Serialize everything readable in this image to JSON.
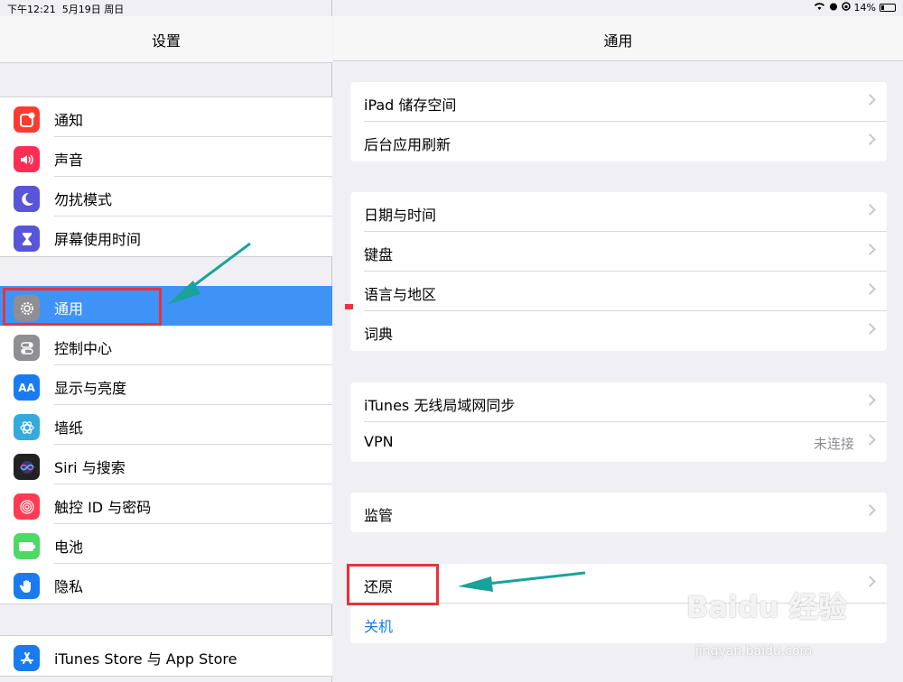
{
  "status": {
    "time": "下午12:21",
    "date": "5月19日 周日",
    "battery": "14%"
  },
  "sidebar": {
    "title": "设置",
    "group1": [
      {
        "label": "通知",
        "icon": "notifications-icon",
        "color": "#fd3b30"
      },
      {
        "label": "声音",
        "icon": "speaker-icon",
        "color": "#fd2d55"
      },
      {
        "label": "勿扰模式",
        "icon": "moon-icon",
        "color": "#5856d6"
      },
      {
        "label": "屏幕使用时间",
        "icon": "hourglass-icon",
        "color": "#5856d6"
      }
    ],
    "group2": [
      {
        "label": "通用",
        "icon": "gear-icon",
        "color": "#8e8e93"
      },
      {
        "label": "控制中心",
        "icon": "toggles-icon",
        "color": "#8e8e93"
      },
      {
        "label": "显示与亮度",
        "icon": "text-size-icon",
        "color": "#1a7bf0"
      },
      {
        "label": "墙纸",
        "icon": "flower-icon",
        "color": "#35aadc"
      },
      {
        "label": "Siri 与搜索",
        "icon": "siri-icon",
        "color": "#222222"
      },
      {
        "label": "触控 ID 与密码",
        "icon": "fingerprint-icon",
        "color": "#fd3b54"
      },
      {
        "label": "电池",
        "icon": "battery-icon",
        "color": "#4cd964"
      },
      {
        "label": "隐私",
        "icon": "hand-icon",
        "color": "#1a7bf0"
      }
    ],
    "group3": [
      {
        "label": "iTunes Store 与 App Store",
        "icon": "app-store-icon",
        "color": "#1a7bf0"
      }
    ]
  },
  "main": {
    "title": "通用",
    "card1": [
      {
        "label": "iPad 储存空间"
      },
      {
        "label": "后台应用刷新"
      }
    ],
    "card2": [
      {
        "label": "日期与时间"
      },
      {
        "label": "键盘"
      },
      {
        "label": "语言与地区"
      },
      {
        "label": "词典"
      }
    ],
    "card3": [
      {
        "label": "iTunes 无线局域网同步"
      },
      {
        "label": "VPN",
        "value": "未连接"
      }
    ],
    "card4": [
      {
        "label": "监管"
      }
    ],
    "card5": [
      {
        "label": "还原"
      },
      {
        "label": "关机"
      }
    ]
  },
  "watermark": {
    "brand": "Baidu 经验",
    "url": "jingyan.baidu.com"
  }
}
